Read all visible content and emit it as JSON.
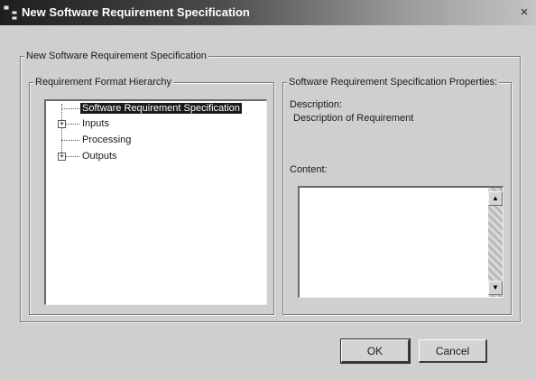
{
  "window": {
    "title": "New Software Requirement Specification",
    "icon": "app-tree-icon",
    "close_label": "×"
  },
  "outer_group": {
    "label": "New Software Requirement Specification"
  },
  "hierarchy": {
    "label": "Requirement Format Hierarchy",
    "items": [
      {
        "label": "Software Requirement Specification",
        "selected": true,
        "expandable": false
      },
      {
        "label": "Inputs",
        "selected": false,
        "expandable": true
      },
      {
        "label": "Processing",
        "selected": false,
        "expandable": false
      },
      {
        "label": "Outputs",
        "selected": false,
        "expandable": true
      }
    ],
    "expander_symbol": "+"
  },
  "properties": {
    "label": "Software Requirement Specification Properties:",
    "description_label": "Description:",
    "description_value": "Description of Requirement",
    "content_label": "Content:",
    "content_value": "",
    "scroll_up_symbol": "▲",
    "scroll_down_symbol": "▼"
  },
  "buttons": {
    "ok_label": "OK",
    "cancel_label": "Cancel"
  },
  "colors": {
    "dialog_background": "#cfcfcf",
    "title_bar_start": "#1e1e1e",
    "selection_background": "#1a1a1a"
  }
}
